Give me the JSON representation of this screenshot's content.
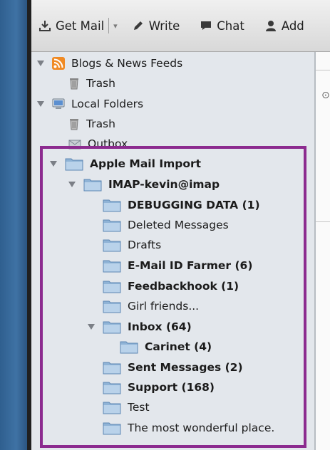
{
  "toolbar": {
    "get_mail_label": "Get Mail",
    "write_label": "Write",
    "chat_label": "Chat",
    "address_book_label": "Add"
  },
  "folders": {
    "blogs_news_feeds": "Blogs & News Feeds",
    "blogs_trash": "Trash",
    "local_folders": "Local Folders",
    "local_trash": "Trash",
    "outbox": "Outbox",
    "apple_mail_import": "Apple Mail Import",
    "imap_account": "IMAP-kevin@imap",
    "debugging_data": "DEBUGGING DATA (1)",
    "deleted_messages": "Deleted Messages",
    "drafts": "Drafts",
    "email_id_farmer": "E-Mail ID Farmer (6)",
    "feedbackhook": "Feedbackhook (1)",
    "girl_friends": "Girl friends...",
    "inbox": "Inbox (64)",
    "carinet": "Carinet (4)",
    "sent_messages": "Sent Messages (2)",
    "support": "Support (168)",
    "test": "Test",
    "wonderful_place": "The most wonderful place."
  },
  "icons": {
    "get_mail": "download-icon",
    "write": "pencil-icon",
    "chat": "chat-bubble-icon",
    "address_book": "person-icon",
    "feed": "rss-icon",
    "trash": "trash-icon",
    "local": "computer-icon",
    "outbox": "outbox-icon",
    "folder": "folder-icon"
  },
  "colors": {
    "highlight_border": "#8c2b8f",
    "folder_blue": "#8fb3d6",
    "pane_background": "#e3e7ec"
  }
}
